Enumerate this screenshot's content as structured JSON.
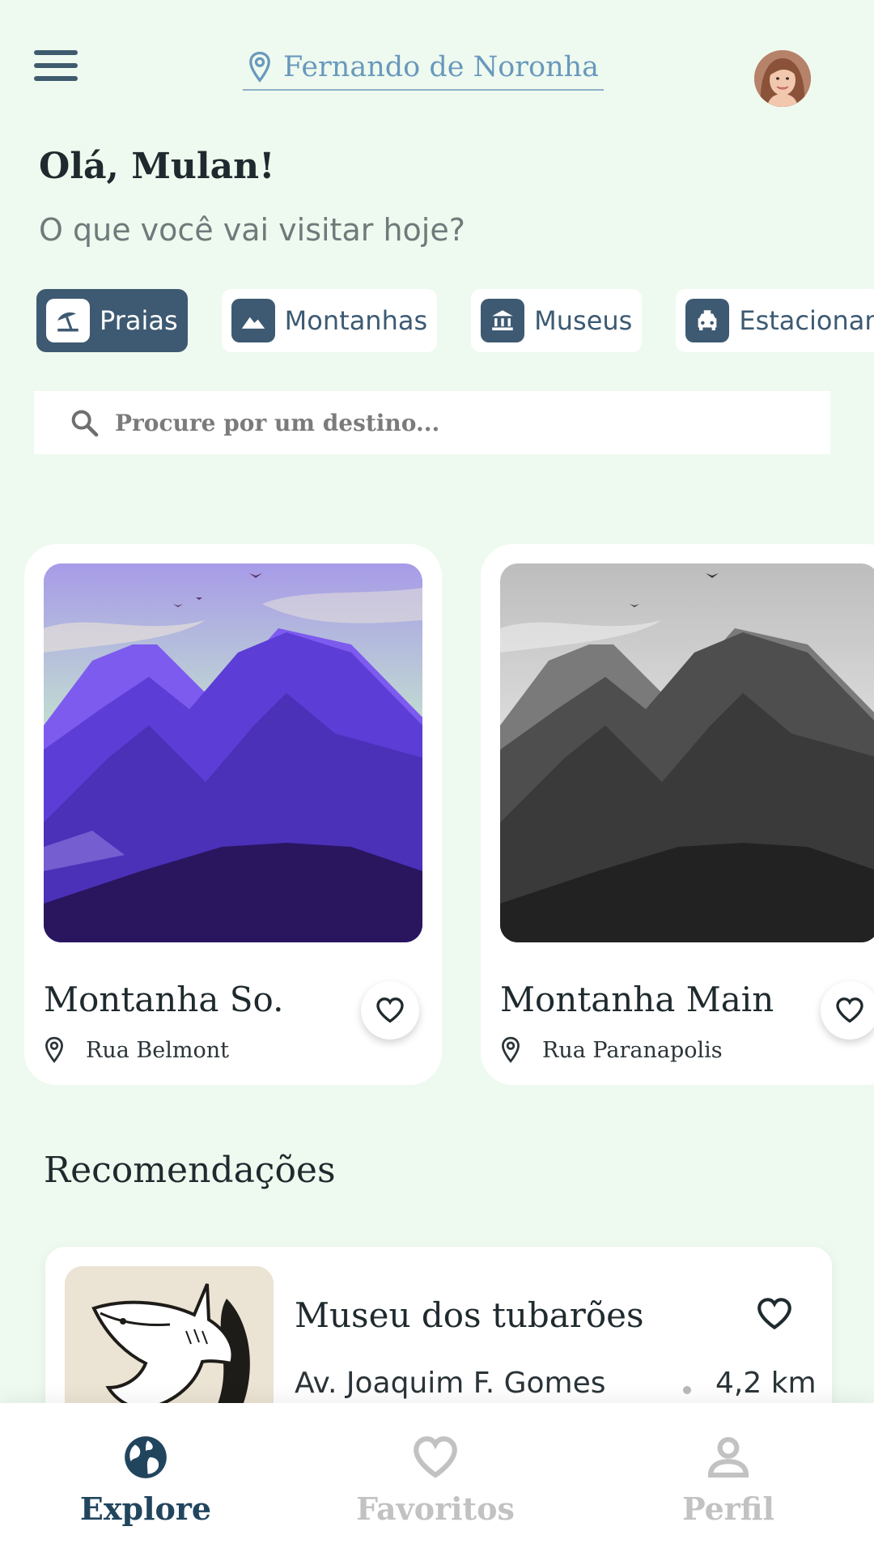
{
  "header": {
    "location": "Fernando de Noronha",
    "menu_icon": "hamburger-menu-icon",
    "avatar_icon": "user-avatar"
  },
  "greeting": {
    "title": "Olá, Mulan!",
    "subtitle": "O que você vai visitar hoje?"
  },
  "categories": [
    {
      "label": "Praias",
      "icon": "beach-umbrella-icon",
      "active": true
    },
    {
      "label": "Montanhas",
      "icon": "mountain-icon",
      "active": false
    },
    {
      "label": "Museus",
      "icon": "museum-icon",
      "active": false
    },
    {
      "label": "Estacionamento",
      "icon": "taxi-icon",
      "active": false
    }
  ],
  "search": {
    "placeholder": "Procure por um destino...",
    "value": ""
  },
  "featured": [
    {
      "title": "Montanha So.",
      "address": "Rua Belmont",
      "image": "purple-mountains"
    },
    {
      "title": "Montanha Main",
      "address": "Rua Paranapolis",
      "image": "grey-mountains"
    }
  ],
  "recommendations": {
    "title": "Recomendações",
    "items": [
      {
        "title": "Museu dos tubarões",
        "address": "Av. Joaquim F. Gomes",
        "distance": "4,2 km",
        "image": "shark-drawing"
      }
    ]
  },
  "nav": {
    "explore": "Explore",
    "favorites": "Favoritos",
    "profile": "Perfil"
  },
  "colors": {
    "background": "#eefaef",
    "accent": "#3e5a72",
    "location_text": "#6a98bd",
    "nav_active": "#22455e",
    "nav_inactive": "#c2c2c2"
  }
}
